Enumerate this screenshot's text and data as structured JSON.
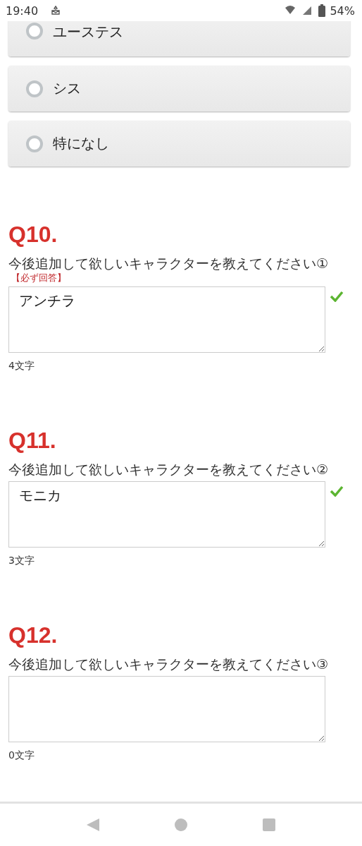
{
  "status_bar": {
    "time": "19:40",
    "battery": "54%"
  },
  "options": [
    {
      "label": "ユーステス",
      "selected": false
    },
    {
      "label": "シス",
      "selected": false
    },
    {
      "label": "特になし",
      "selected": false
    }
  ],
  "questions": [
    {
      "number": "Q10.",
      "text": "今後追加して欲しいキャラクターを教えてください①",
      "required_note": "【必ず回答】",
      "value": "アンチラ",
      "count": "4文字",
      "valid": true
    },
    {
      "number": "Q11.",
      "text": "今後追加して欲しいキャラクターを教えてください②",
      "value": "モニカ",
      "count": "3文字",
      "valid": true
    },
    {
      "number": "Q12.",
      "text": "今後追加して欲しいキャラクターを教えてください③",
      "count": "0文字",
      "valid": false
    }
  ]
}
